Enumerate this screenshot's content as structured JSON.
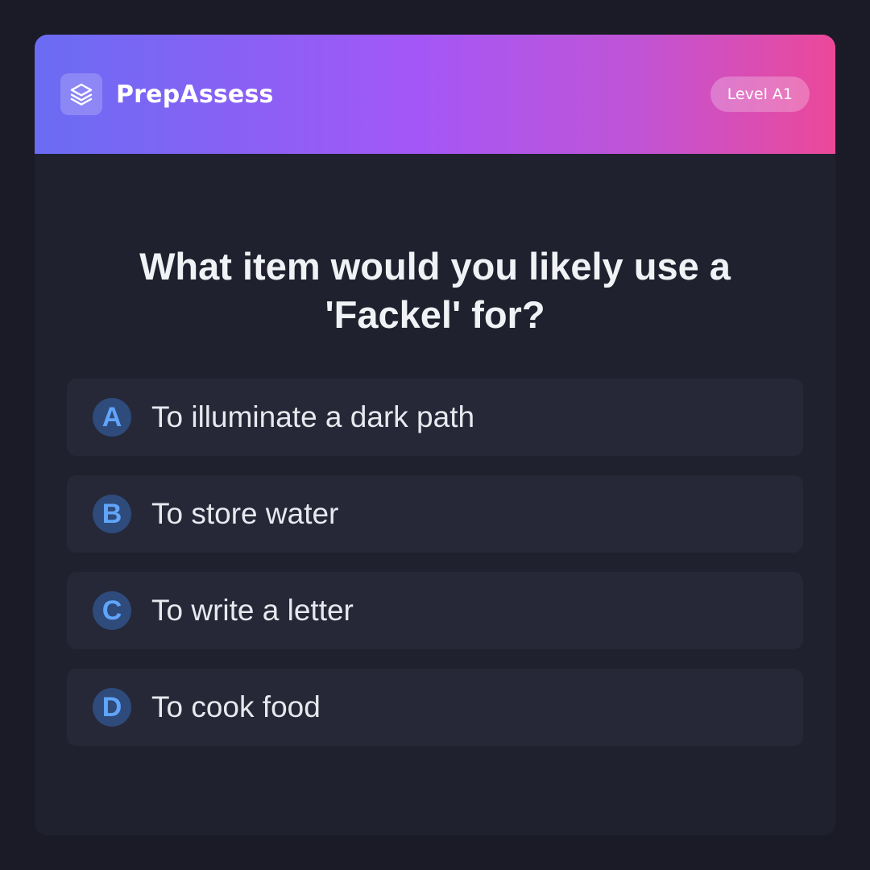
{
  "app": {
    "name": "PrepAssess",
    "logo_icon": "layers-icon",
    "level_badge": "Level A1"
  },
  "colors": {
    "background": "#1a1b26",
    "card": "#1f212e",
    "option_bg": "#262837",
    "header_gradient": [
      "#6a6cf3",
      "#a457f6",
      "#ec4899"
    ],
    "option_letter_bg": "#2e4b7c",
    "option_letter_fg": "#60a5fa"
  },
  "quiz": {
    "question": "What item would you likely use a 'Fackel' for?",
    "options": [
      {
        "letter": "A",
        "text": "To illuminate a dark path"
      },
      {
        "letter": "B",
        "text": "To store water"
      },
      {
        "letter": "C",
        "text": "To write a letter"
      },
      {
        "letter": "D",
        "text": "To cook food"
      }
    ]
  }
}
